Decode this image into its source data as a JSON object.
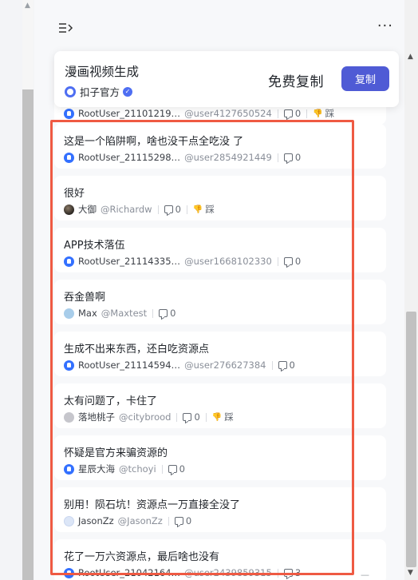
{
  "bot": {
    "title": "漫画视频生成",
    "author": "扣子官方",
    "free_copy_label": "免费复制",
    "copy_button": "复制"
  },
  "comments": [
    {
      "text": "",
      "name": "RootUser_21101219…",
      "handle": "@user4127650524",
      "replies": "0",
      "dislike_label": "踩",
      "avatar": "bot"
    },
    {
      "text": "这是一个陷阱啊，啥也没干点全吃没 了",
      "name": "RootUser_21115298…",
      "handle": "@user2854921449",
      "replies": "0",
      "dislike_label": "",
      "avatar": "bot"
    },
    {
      "text": "很好",
      "name": "大御",
      "handle": "@Richardw",
      "replies": "0",
      "dislike_label": "踩",
      "avatar": "photo"
    },
    {
      "text": "APP技术落伍",
      "name": "RootUser_21114335…",
      "handle": "@user1668102330",
      "replies": "0",
      "dislike_label": "",
      "avatar": "bot"
    },
    {
      "text": "吞金兽啊",
      "name": "Max",
      "handle": "@Maxtest",
      "replies": "0",
      "dislike_label": "",
      "avatar": "light"
    },
    {
      "text": "生成不出来东西，还白吃资源点",
      "name": "RootUser_21114594…",
      "handle": "@user276627384",
      "replies": "0",
      "dislike_label": "",
      "avatar": "bot"
    },
    {
      "text": "太有问题了，卡住了",
      "name": "落地桃子",
      "handle": "@citybrood",
      "replies": "0",
      "dislike_label": "踩",
      "avatar": "grey"
    },
    {
      "text": "怀疑是官方来骗资源的",
      "name": "星辰大海",
      "handle": "@tchoyi",
      "replies": "0",
      "dislike_label": "",
      "avatar": "bot"
    },
    {
      "text": "别用！陨石坑！资源点一万直接全没了",
      "name": "JasonZz",
      "handle": "@JasonZz",
      "replies": "0",
      "dislike_label": "",
      "avatar": "pale"
    },
    {
      "text": "花了一万六资源点，最后啥也没有",
      "name": "RootUser_21042164…",
      "handle": "@user2439859315",
      "replies": "3",
      "dislike_label": "",
      "avatar": "bot"
    }
  ],
  "icons": {
    "menu": "menu-collapse-icon",
    "more": "more-horizontal-icon",
    "reply": "comment-icon",
    "dislike": "thumbs-down-icon",
    "verified": "verified-badge-icon"
  },
  "colors": {
    "accent": "#4f5bd5",
    "selection": "#ef5a43",
    "bot_avatar": "#3370ff"
  }
}
